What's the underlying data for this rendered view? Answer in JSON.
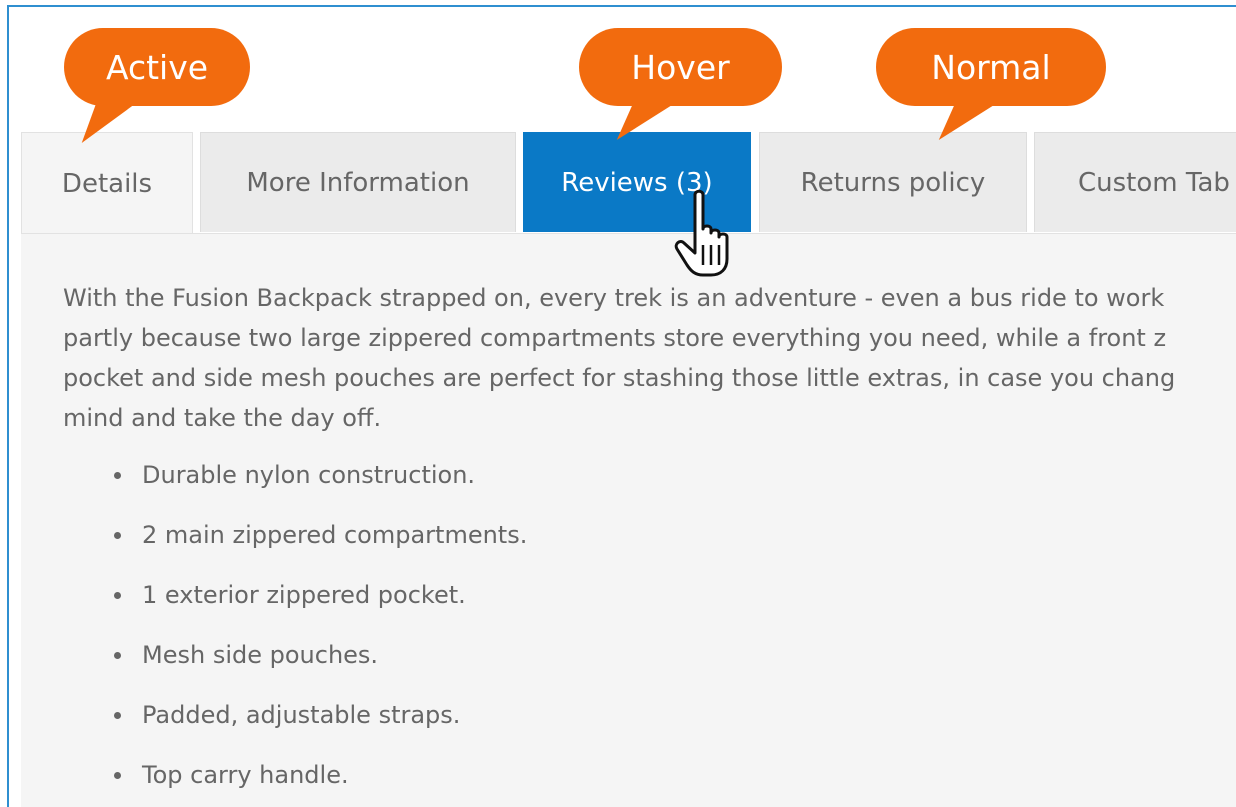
{
  "callouts": {
    "active": "Active",
    "hover": "Hover",
    "normal": "Normal"
  },
  "tabs": [
    {
      "label": "Details",
      "state": "active"
    },
    {
      "label": "More Information",
      "state": "normal"
    },
    {
      "label": "Reviews (3)",
      "state": "hover"
    },
    {
      "label": "Returns policy",
      "state": "normal"
    },
    {
      "label": "Custom Tab",
      "state": "normal"
    }
  ],
  "content": {
    "description_lines": [
      "With the Fusion Backpack strapped on, every trek is an adventure - even a bus ride to work",
      "partly because two large zippered compartments store everything you need, while a front z",
      "pocket and side mesh pouches are perfect for stashing those little extras, in case you chang",
      "mind and take the day off."
    ],
    "features": [
      "Durable nylon construction.",
      "2 main zippered compartments.",
      "1 exterior zippered pocket.",
      "Mesh side pouches.",
      "Padded, adjustable straps.",
      "Top carry handle."
    ]
  },
  "colors": {
    "callout": "#f26b0e",
    "hover_tab": "#0a79c6",
    "frame_border": "#2f8fd0",
    "text": "#666666"
  },
  "icons": {
    "cursor": "hand-pointer-icon"
  }
}
